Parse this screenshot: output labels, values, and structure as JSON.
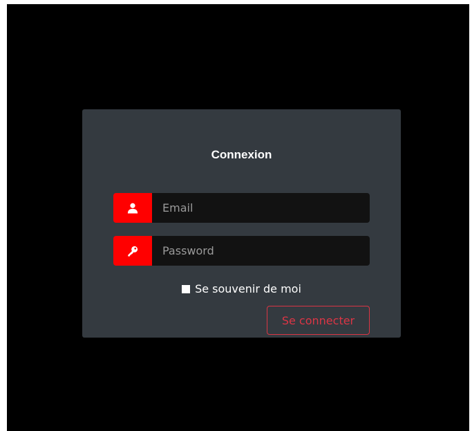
{
  "login": {
    "title": "Connexion",
    "email_placeholder": "Email",
    "password_placeholder": "Password",
    "remember_label": "Se souvenir de moi",
    "submit_label": "Se connecter"
  },
  "icons": {
    "email": "user-icon",
    "password": "key-icon"
  },
  "colors": {
    "accent": "#ff0000",
    "button": "#dc3545",
    "card": "#343a40",
    "field": "#121212",
    "background": "#000000"
  }
}
